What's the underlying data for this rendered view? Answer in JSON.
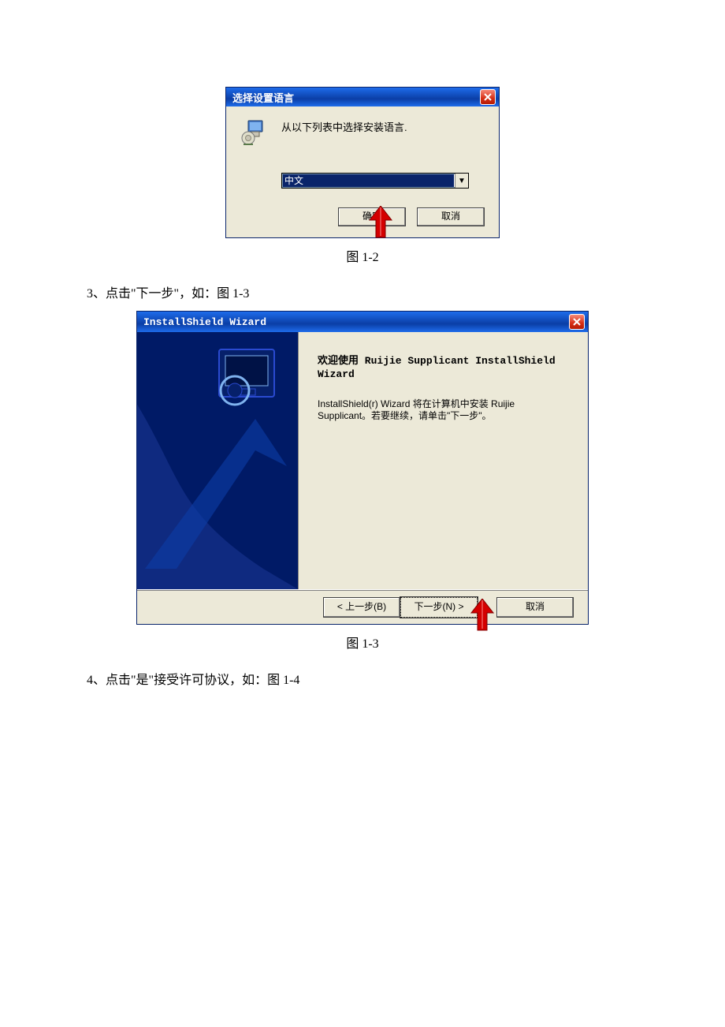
{
  "dialog1": {
    "title": "选择设置语言",
    "prompt": "从以下列表中选择安装语言.",
    "dropdown_selected": "中文",
    "ok_label": "确定",
    "cancel_label": "取消"
  },
  "caption1": "图 1-2",
  "instruction1": "3、点击\"下一步\"，如：图 1-3",
  "dialog2": {
    "title": "InstallShield Wizard",
    "heading": "欢迎使用 Ruijie Supplicant InstallShield Wizard",
    "body": "InstallShield(r) Wizard 将在计算机中安装 Ruijie Supplicant。若要继续，请单击\"下一步\"。",
    "back_label": "< 上一步(B)",
    "next_label": "下一步(N) >",
    "cancel_label": "取消"
  },
  "caption2": "图 1-3",
  "instruction2": "4、点击\"是\"接受许可协议，如：图 1-4"
}
